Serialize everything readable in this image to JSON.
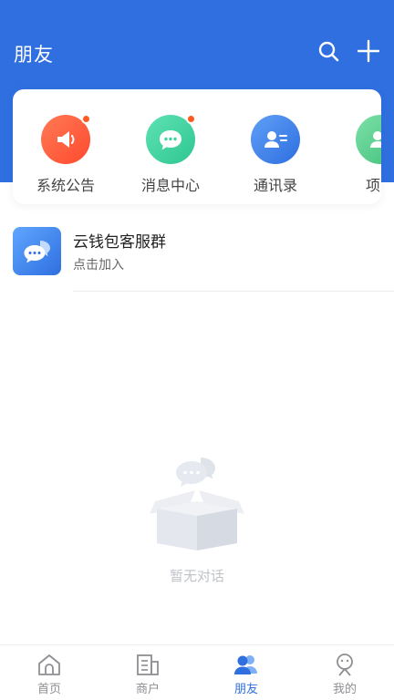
{
  "header": {
    "title": "朋友",
    "search_icon": "search-icon",
    "add_icon": "plus-icon",
    "bg_color": "#2f6fe0"
  },
  "quick": {
    "items": [
      {
        "label": "系统公告",
        "icon": "megaphone-icon",
        "color": "#ff5b3a",
        "badge": true
      },
      {
        "label": "消息中心",
        "icon": "chat-bubble-icon",
        "color": "#3fd3a0",
        "badge": true
      },
      {
        "label": "通讯录",
        "icon": "contact-card-icon",
        "color": "#3a82f0",
        "badge": false
      },
      {
        "label": "项目",
        "icon": "people-icon",
        "color": "#54d08a",
        "badge": false
      }
    ]
  },
  "group": {
    "name": "云钱包客服群",
    "subtitle": "点击加入",
    "icon": "chat-bubbles-icon"
  },
  "empty": {
    "text": "暂无对话",
    "icon": "empty-box-icon"
  },
  "tabs": [
    {
      "label": "首页",
      "icon": "home-icon",
      "active": false
    },
    {
      "label": "商户",
      "icon": "merchant-icon",
      "active": false
    },
    {
      "label": "朋友",
      "icon": "friends-icon",
      "active": true
    },
    {
      "label": "我的",
      "icon": "profile-icon",
      "active": false
    }
  ]
}
